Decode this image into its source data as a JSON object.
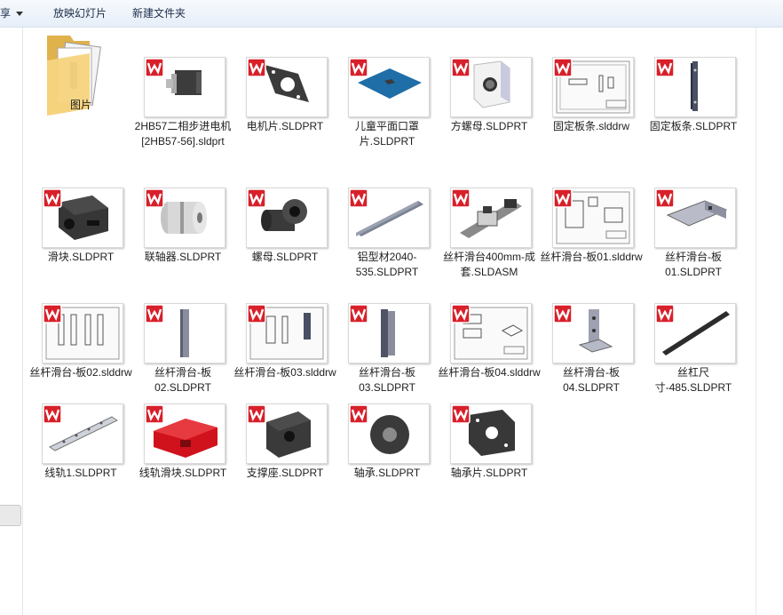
{
  "toolbar": {
    "share_label": "共享",
    "slideshow_label": "放映幻灯片",
    "new_folder_label": "新建文件夹"
  },
  "files": {
    "f0": {
      "name": "图片"
    },
    "f1": {
      "name": "2HB57二相步进电机[2HB57-56].sldprt"
    },
    "f2": {
      "name": "电机片.SLDPRT"
    },
    "f3": {
      "name": "儿童平面口罩片.SLDPRT"
    },
    "f4": {
      "name": "方螺母.SLDPRT"
    },
    "f5": {
      "name": "固定板条.slddrw"
    },
    "f6": {
      "name": "固定板条.SLDPRT"
    },
    "f7": {
      "name": "滑块.SLDPRT"
    },
    "f8": {
      "name": "联轴器.SLDPRT"
    },
    "f9": {
      "name": "螺母.SLDPRT"
    },
    "f10": {
      "name": "铝型材2040-535.SLDPRT"
    },
    "f11": {
      "name": "丝杆滑台400mm-成套.SLDASM"
    },
    "f12": {
      "name": "丝杆滑台-板01.slddrw"
    },
    "f13": {
      "name": "丝杆滑台-板01.SLDPRT"
    },
    "f14": {
      "name": "丝杆滑台-板02.slddrw"
    },
    "f15": {
      "name": "丝杆滑台-板02.SLDPRT"
    },
    "f16": {
      "name": "丝杆滑台-板03.slddrw"
    },
    "f17": {
      "name": "丝杆滑台-板03.SLDPRT"
    },
    "f18": {
      "name": "丝杆滑台-板04.slddrw"
    },
    "f19": {
      "name": "丝杆滑台-板04.SLDPRT"
    },
    "f20": {
      "name": "丝杠尺寸-485.SLDPRT"
    },
    "f21": {
      "name": "线轨1.SLDPRT"
    },
    "f22": {
      "name": "线轨滑块.SLDPRT"
    },
    "f23": {
      "name": "支撑座.SLDPRT"
    },
    "f24": {
      "name": "轴承.SLDPRT"
    },
    "f25": {
      "name": "轴承片.SLDPRT"
    }
  },
  "icons": {
    "solidworks_badge": "solidworks-icon",
    "folder": "folder-icon"
  },
  "colors": {
    "sw_badge_red": "#d8202a",
    "toolbar_bg": "#e6eef8",
    "part_gray": "#3a3a3a",
    "blue_part": "#1f6ea8",
    "red_part": "#d0121c"
  }
}
